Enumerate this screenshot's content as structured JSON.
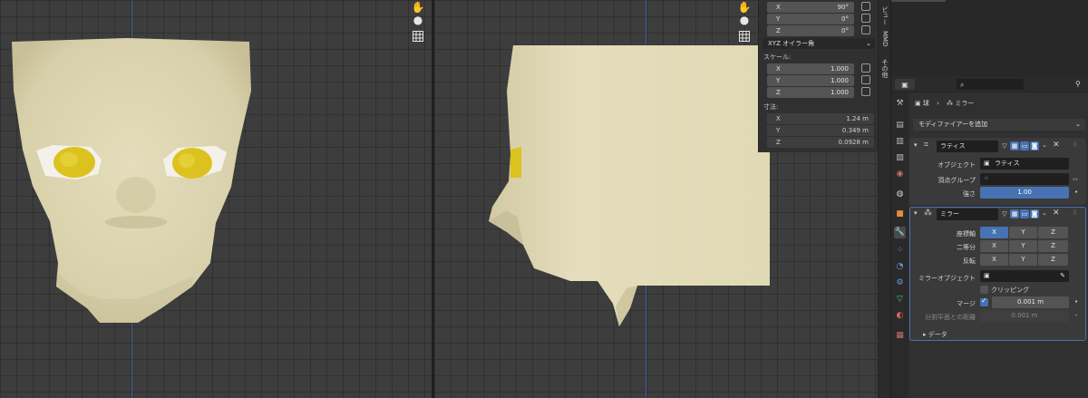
{
  "npanel": {
    "rotation": [
      {
        "axis": "X",
        "value": "90°"
      },
      {
        "axis": "Y",
        "value": "0°"
      },
      {
        "axis": "Z",
        "value": "0°"
      }
    ],
    "rotation_mode": "XYZ オイラー角",
    "scale_label": "スケール:",
    "scale": [
      {
        "axis": "X",
        "value": "1.000"
      },
      {
        "axis": "Y",
        "value": "1.000"
      },
      {
        "axis": "Z",
        "value": "1.000"
      }
    ],
    "dimensions_label": "寸法:",
    "dimensions": [
      {
        "axis": "X",
        "value": "1.24 m"
      },
      {
        "axis": "Y",
        "value": "0.349 m"
      },
      {
        "axis": "Z",
        "value": "0.0928 m"
      }
    ]
  },
  "vtabs": {
    "view": "ビュー",
    "mmd": "MMD",
    "other": "その他"
  },
  "props": {
    "breadcrumb_object": "球",
    "breadcrumb_sep": "›",
    "breadcrumb_modifier": "ミラー",
    "add_modifier": "モディファイアーを追加",
    "lattice": {
      "name": "ラティス",
      "object_label": "オブジェクト",
      "object_value": "ラティス",
      "vgroup_label": "頂点グループ",
      "strength_label": "強さ",
      "strength_value": "1.00"
    },
    "mirror": {
      "name": "ミラー",
      "axis_label": "座標軸",
      "bisect_label": "二等分",
      "flip_label": "反転",
      "axes": [
        "X",
        "Y",
        "Z"
      ],
      "axis_on": [
        true,
        false,
        false
      ],
      "mirror_object_label": "ミラーオブジェクト",
      "clipping_label": "クリッピング",
      "merge_label": "マージ",
      "merge_value": "0.001 m",
      "bisect_distance_label": "分割平面との距離",
      "bisect_distance_value": "0.001 m",
      "data_label": "データ"
    }
  },
  "colors": {
    "accent": "#4772b3",
    "skin": "#ddd6b2",
    "eye": "#dcc21e"
  },
  "icons": [
    "hand-icon",
    "camera-icon",
    "grid-icon",
    "lock-icon",
    "wrench-icon",
    "eye-dropper-icon",
    "close-icon",
    "chevron-down-icon",
    "pin-icon",
    "search-icon"
  ]
}
